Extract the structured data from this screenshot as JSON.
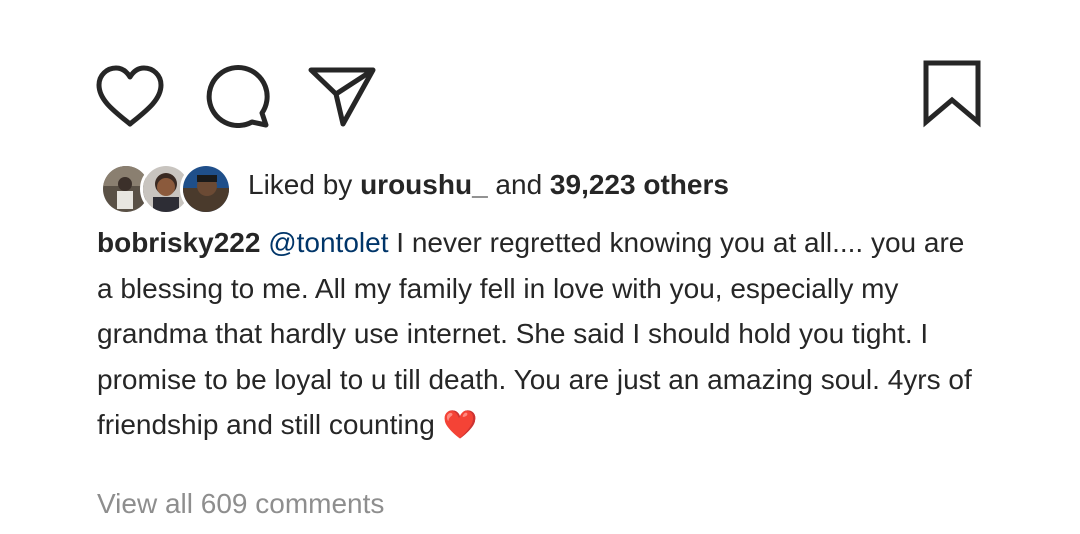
{
  "actions": {
    "like_icon": "heart-outline-icon",
    "comment_icon": "comment-bubble-icon",
    "share_icon": "paper-plane-icon",
    "save_icon": "bookmark-icon"
  },
  "likes": {
    "prefix": "Liked by ",
    "user": "uroushu_",
    "joiner": " and ",
    "others": "39,223 others"
  },
  "caption": {
    "username": "bobrisky222",
    "mention": "@tontolet",
    "text": " I never regretted knowing you at all.... you are a blessing to me. All my family fell in love with you, especially my grandma that hardly use internet. She said I should hold you tight. I promise to be loyal to u till death. You are just an amazing soul. 4yrs of friendship and still counting",
    "emoji": "❤️"
  },
  "comments": {
    "view_all": "View all 609 comments"
  },
  "colors": {
    "text": "#262626",
    "mention": "#003569",
    "muted": "#8e8e8e",
    "heart": "#e0202b"
  }
}
